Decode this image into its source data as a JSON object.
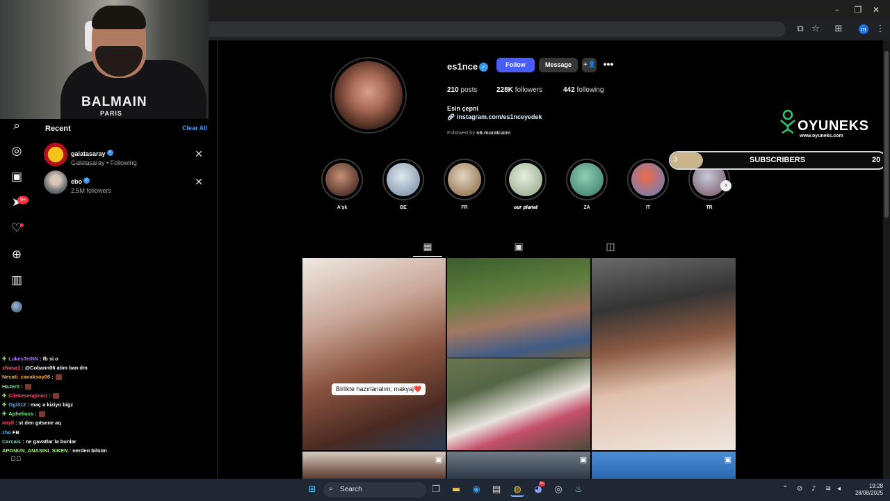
{
  "browser": {
    "minimize": "–",
    "maximize": "❐",
    "close": "✕",
    "profile_initial": "m"
  },
  "sidebar": {
    "notifications_badge": "9+"
  },
  "recent": {
    "title": "Recent",
    "clear_all": "Clear All",
    "items": [
      {
        "name": "galatasaray",
        "sub": "Galatasaray • Following"
      },
      {
        "name": "ebo",
        "sub": "2.5M followers"
      }
    ]
  },
  "webcam": {
    "shirt_brand": "BALMAIN",
    "shirt_city": "PARIS"
  },
  "chat": [
    {
      "user": "LukesTeiNN",
      "color": "#b27cff",
      "plus": true,
      "msg": ": fb si o",
      "emote": false
    },
    {
      "user": "xNasa1",
      "color": "#ff5a7a",
      "plus": false,
      "msg": ": @Cobann06 atim ban dm",
      "emote": false
    },
    {
      "user": "Necati_canaksoy06",
      "color": "#ffb347",
      "plus": false,
      "msg": ":",
      "emote": true
    },
    {
      "user": "HaJer0",
      "color": "#7ef27e",
      "plus": false,
      "msg": ":",
      "emote": true
    },
    {
      "user": "Cilekesenginerr",
      "color": "#ff4b6e",
      "plus": true,
      "msg": ":",
      "emote": true
    },
    {
      "user": "Ogi312",
      "color": "#5ab4ff",
      "plus": true,
      "msg": ": maç a kiziyo bigz",
      "emote": false
    },
    {
      "user": "Apheliuss",
      "color": "#7ef27e",
      "plus": true,
      "msg": ":",
      "emote": true
    },
    {
      "user": "imyll",
      "color": "#ff4b6e",
      "plus": false,
      "msg": ": st den gıtsene aq",
      "emote": false
    },
    {
      "user": "zho",
      "color": "#5ab4ff",
      "plus": false,
      "msg": "FB",
      "emote": false
    },
    {
      "user": "Carcais",
      "color": "#7fd6c8",
      "plus": false,
      "msg": ": ne gavatlar la bunlar",
      "emote": false
    },
    {
      "user": "APONUN_ANASINI_SIKEN",
      "color": "#9cff6a",
      "plus": false,
      "msg": ": nerden bilüün",
      "emote": false
    }
  ],
  "profile": {
    "username": "es1nce",
    "follow_label": "Follow",
    "message_label": "Message",
    "add_user_glyph": "+👤",
    "more_glyph": "•••",
    "posts_count": "210",
    "posts_label": "posts",
    "followers_count": "228K",
    "followers_label": "followers",
    "following_count": "442",
    "following_label": "following",
    "full_name": "Esin çepni",
    "link": "instagram.com/es1nceyedek",
    "followed_by_prefix": "Followed by",
    "followed_by_user": "o6.muratcann"
  },
  "highlights": [
    {
      "label": "A'şk",
      "c1": "#c8907a",
      "c2": "#3b2119"
    },
    {
      "label": "BE",
      "c1": "#dfe8ef",
      "c2": "#7c8fa6"
    },
    {
      "label": "FR",
      "c1": "#e6d7c0",
      "c2": "#8a6b4a"
    },
    {
      "label": "𝒐𝒖𝒓 𝒑𝒍𝒂𝒏𝒆𝒕",
      "c1": "#e7efe0",
      "c2": "#93a88a"
    },
    {
      "label": "ZA",
      "c1": "#8fd0b6",
      "c2": "#3f7d6a"
    },
    {
      "label": "IT",
      "c1": "#ef6a4a",
      "c2": "#6b7fb8"
    },
    {
      "label": "TR",
      "c1": "#c9c9d9",
      "c2": "#7a5c6c"
    }
  ],
  "post_caption": "Birlikte hazırlanalım; makyaj❤️",
  "overlay": {
    "brand": "OYUNEKS",
    "url": "www.oyuneks.com",
    "sub_current": "3",
    "sub_label": "SUBSCRIBERS",
    "sub_goal": "20",
    "sub_progress": 0.15
  },
  "taskbar": {
    "search_label": "Search",
    "time": "19:28",
    "date": "28/08/2025",
    "discord_badge": "9+"
  }
}
